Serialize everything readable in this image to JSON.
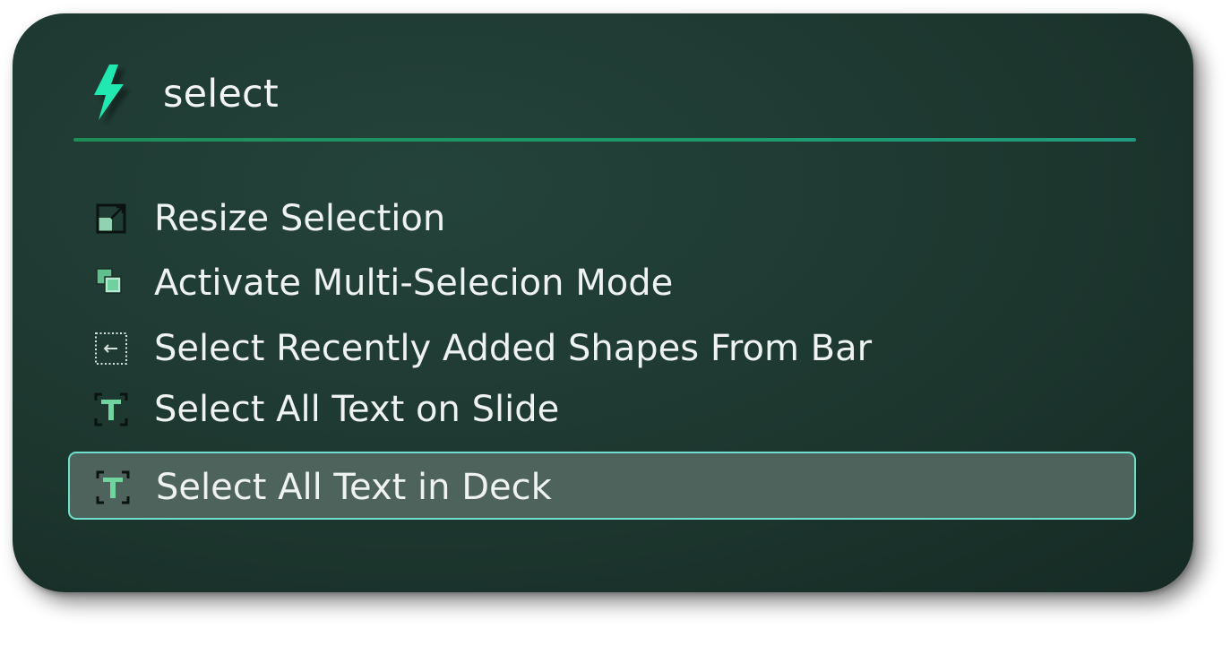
{
  "palette": {
    "panel_bg": "#1e3a32",
    "accent_green": "#1db86e",
    "bolt_color": "#21e8b0",
    "selection_bg": "#4f635d",
    "selection_border": "#6fe0cc",
    "text": "#eef2f0"
  },
  "search": {
    "icon": "lightning-bolt-icon",
    "query": "select"
  },
  "results": [
    {
      "label": "Resize Selection",
      "icon": "resize-selection-icon",
      "selected": false
    },
    {
      "label": "Activate Multi-Selecion Mode",
      "icon": "multi-select-icon",
      "selected": false
    },
    {
      "label": "Select Recently Added Shapes From Bar",
      "icon": "select-recent-shapes-icon",
      "selected": false
    },
    {
      "label": "Select All Text on Slide",
      "icon": "text-select-icon",
      "selected": false
    },
    {
      "label": "Select All Text in Deck",
      "icon": "text-select-icon",
      "selected": true
    }
  ]
}
